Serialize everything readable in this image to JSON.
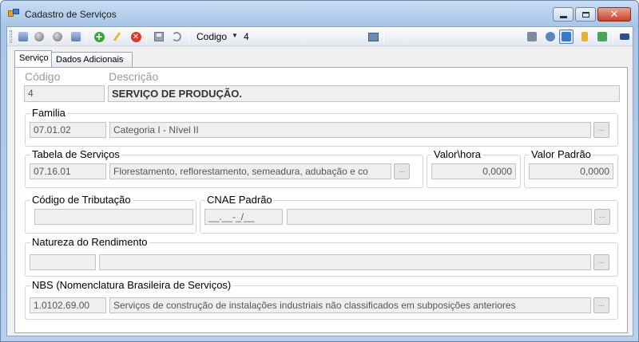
{
  "window": {
    "title": "Cadastro de Serviços"
  },
  "toolbar": {
    "search_field_label": "Codigo",
    "search_value": "4"
  },
  "tabs": [
    {
      "label": "Serviço"
    },
    {
      "label": "Dados Adicionais"
    }
  ],
  "main": {
    "codigo": {
      "label": "Código",
      "value": "4"
    },
    "descricao": {
      "label": "Descrição",
      "value": "SERVIÇO DE PRODUÇÃO."
    }
  },
  "familia": {
    "title": "Familia",
    "code": "07.01.02",
    "description": "Categoria I - Nível II",
    "lookup": "..."
  },
  "tabela": {
    "title": "Tabela de Serviços",
    "code": "07.16.01",
    "description": "Florestamento, reflorestamento, semeadura, adubação e co",
    "lookup": "..."
  },
  "valor_hora": {
    "title": "Valor\\hora",
    "value": "0,0000"
  },
  "valor_padrao": {
    "title": "Valor Padrão",
    "value": "0,0000"
  },
  "tributacao": {
    "title": "Código de Tributação",
    "value": ""
  },
  "cnae": {
    "title": "CNAE Padrão",
    "code": "__.__-_/__",
    "description": "",
    "lookup": "..."
  },
  "natureza": {
    "title": "Natureza do Rendimento",
    "code": "",
    "description": "",
    "lookup": "..."
  },
  "nbs": {
    "title": "NBS (Nomenclatura Brasileira de Serviços)",
    "code": "1.0102.69.00",
    "description": "Serviços de construção de instalações industriais não classificados em subposições anteriores",
    "lookup": "..."
  }
}
